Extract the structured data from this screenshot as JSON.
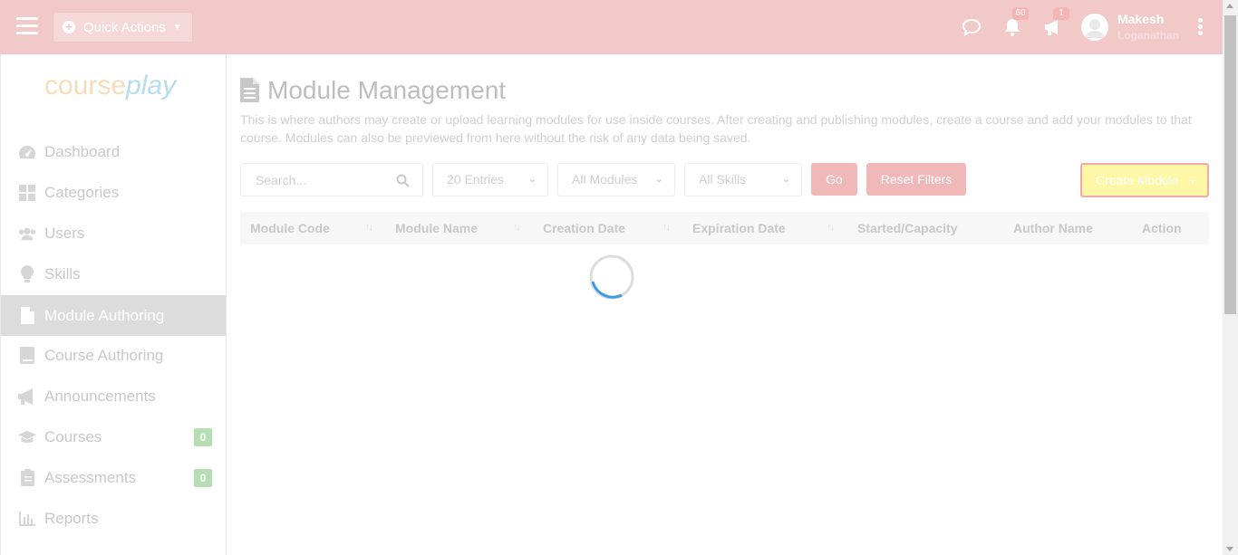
{
  "header": {
    "quick_actions_label": "Quick Actions",
    "notifications_count": "60",
    "announcements_count": "1",
    "user_first_name": "Makesh",
    "user_last_name": "Loganathan"
  },
  "logo": {
    "part1": "course",
    "part2": "play"
  },
  "sidebar": {
    "items": [
      {
        "label": "Dashboard",
        "icon": "gauge-icon"
      },
      {
        "label": "Categories",
        "icon": "grid-icon"
      },
      {
        "label": "Users",
        "icon": "users-icon"
      },
      {
        "label": "Skills",
        "icon": "lightbulb-icon"
      },
      {
        "label": "Module Authoring",
        "icon": "document-icon",
        "active": true
      },
      {
        "label": "Course Authoring",
        "icon": "book-icon"
      },
      {
        "label": "Announcements",
        "icon": "megaphone-icon"
      },
      {
        "label": "Courses",
        "icon": "graduation-cap-icon",
        "count": "0"
      },
      {
        "label": "Assessments",
        "icon": "clipboard-icon",
        "count": "0"
      },
      {
        "label": "Reports",
        "icon": "bar-chart-icon"
      }
    ]
  },
  "main": {
    "title": "Module Management",
    "description": "This is where authors may create or upload learning modules for use inside courses. After creating and publishing modules, create a course and add your modules to that course. Modules can also be previewed from here without the risk of any data being saved.",
    "search_placeholder": "Search...",
    "entries_select": "20 Entries",
    "modules_select": "All Modules",
    "skills_select": "All Skills",
    "go_label": "Go",
    "reset_label": "Reset Filters",
    "create_label": "Create Module",
    "columns": [
      "Module Code",
      "Module Name",
      "Creation Date",
      "Expiration Date",
      "Started/Capacity",
      "Author Name",
      "Action"
    ]
  },
  "colors": {
    "topbar": "#f2c9c9",
    "button": "#f0b8b8",
    "create_button": "#fdf7a6",
    "count_badge": "#b7deb2",
    "active_nav": "#dcdcdc"
  }
}
